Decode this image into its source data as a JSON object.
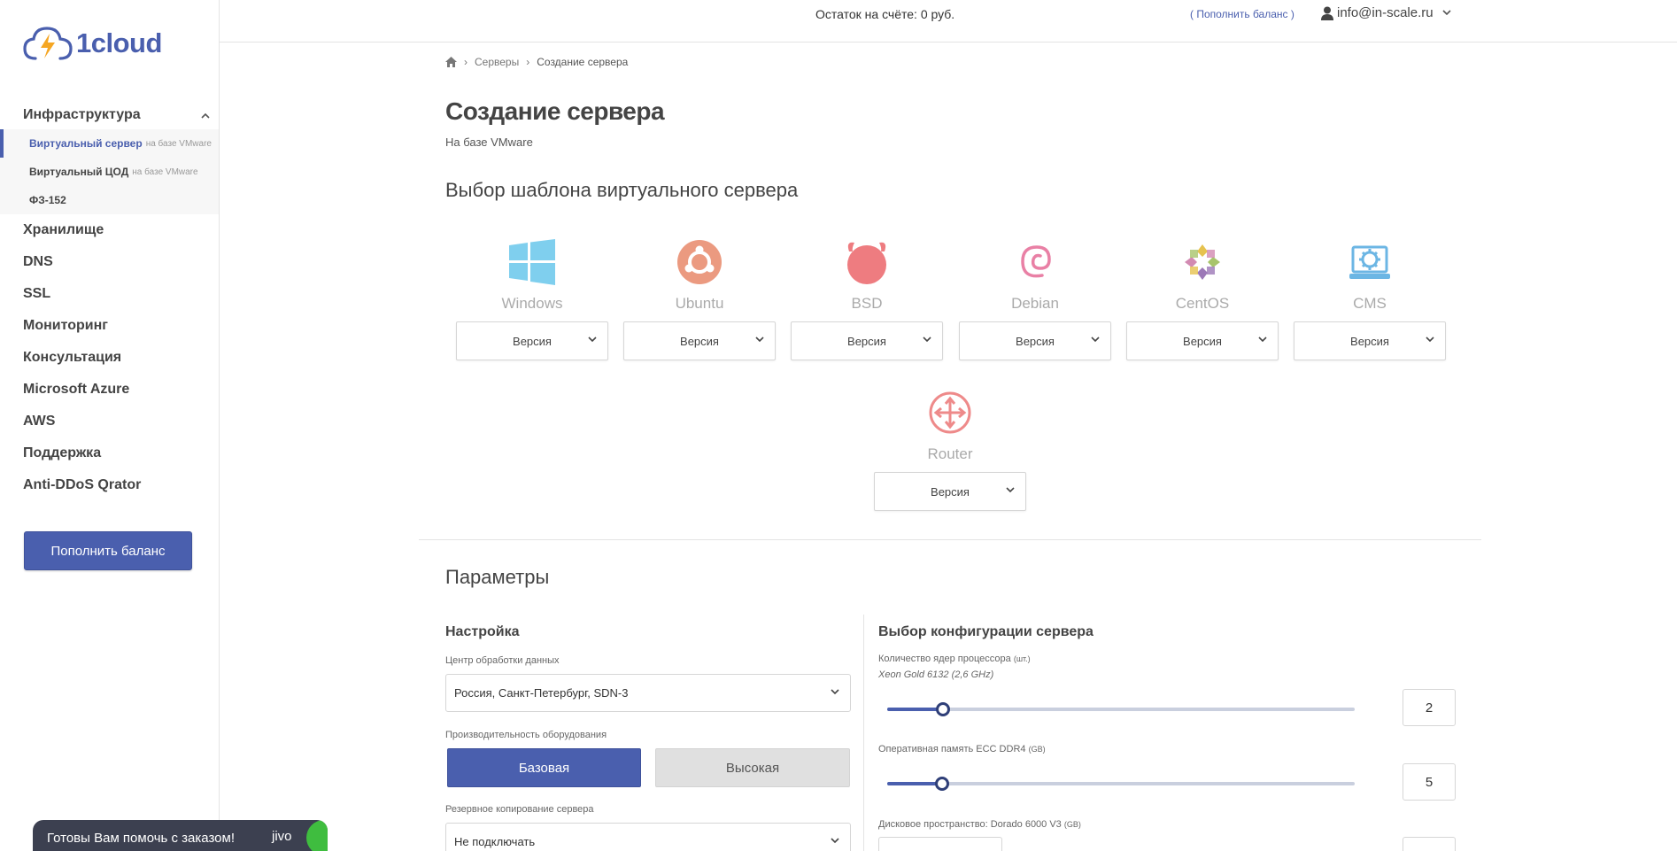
{
  "app": {
    "logo_text": "1cloud"
  },
  "header": {
    "balance_text": "Остаток на счёте: 0 руб.",
    "topup_link": "( Пополнить баланс )",
    "user_email": "info@in-scale.ru"
  },
  "sidebar": {
    "group": {
      "label": "Инфраструктура",
      "items": [
        {
          "label": "Виртуальный сервер",
          "suffix": "на базе VMware"
        },
        {
          "label": "Виртуальный ЦОД",
          "suffix": "на базе VMware"
        },
        {
          "label": "ФЗ-152"
        }
      ]
    },
    "items": [
      "Хранилище",
      "DNS",
      "SSL",
      "Мониторинг",
      "Консультация",
      "Microsoft Azure",
      "AWS",
      "Поддержка",
      "Anti-DDoS Qrator"
    ],
    "topup_button": "Пополнить баланс"
  },
  "breadcrumb": {
    "servers": "Серверы",
    "current": "Создание сервера"
  },
  "page": {
    "title": "Создание сервера",
    "subtitle": "На базе VMware"
  },
  "templates": {
    "title": "Выбор шаблона виртуального сервера",
    "version_label": "Версия",
    "items": [
      {
        "name": "Windows",
        "icon": "windows-icon"
      },
      {
        "name": "Ubuntu",
        "icon": "ubuntu-icon"
      },
      {
        "name": "BSD",
        "icon": "bsd-icon"
      },
      {
        "name": "Debian",
        "icon": "debian-icon"
      },
      {
        "name": "CentOS",
        "icon": "centos-icon"
      },
      {
        "name": "CMS",
        "icon": "cms-gear-icon"
      },
      {
        "name": "Router",
        "icon": "router-icon"
      }
    ]
  },
  "params": {
    "title": "Параметры",
    "setup": {
      "title": "Настройка",
      "dc_label": "Центр обработки данных",
      "dc_value": "Россия, Санкт-Петербург, SDN-3",
      "perf_label": "Производительность оборудования",
      "perf_base": "Базовая",
      "perf_high": "Высокая",
      "backup_label": "Резервное копирование сервера",
      "backup_value": "Не подключать"
    },
    "config": {
      "title": "Выбор конфигурации сервера",
      "cpu_label": "Количество ядер процессора",
      "cpu_unit": "(шт.)",
      "cpu_hint": "Xeon Gold 6132 (2,6 GHz)",
      "cpu_value": "2",
      "cpu_fraction": 0.12,
      "ram_label": "Оперативная память ECC DDR4",
      "ram_unit": "(GB)",
      "ram_value": "5",
      "ram_fraction": 0.118,
      "disk_label": "Дисковое пространство: Dorado 6000 V3",
      "disk_unit": "(GB)"
    }
  },
  "chat": {
    "text": "Готовы Вам помочь с заказом!",
    "brand": "jivo"
  },
  "colors": {
    "accent": "#4a5fae",
    "windows": "#7fcfee",
    "ubuntu": "#eb9a80",
    "bsd": "#ee7c80",
    "debian": "#e980a5",
    "cms": "#6cb6e4",
    "router": "#ee8a8a"
  }
}
